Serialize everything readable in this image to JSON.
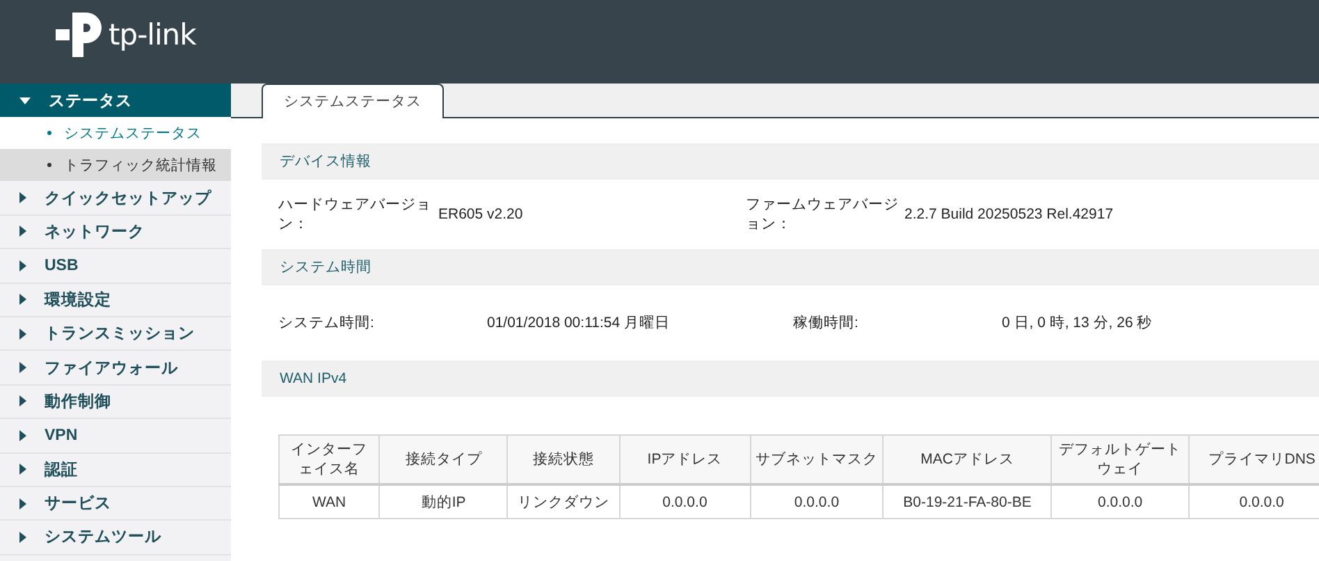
{
  "header": {
    "logo_text": "tp-link"
  },
  "sidebar": {
    "items": [
      {
        "label": "ステータス",
        "expanded": true,
        "selected": true,
        "children": [
          {
            "label": "システムステータス",
            "selected": true,
            "highlighted": false
          },
          {
            "label": "トラフィック統計情報",
            "selected": false,
            "highlighted": true
          }
        ]
      },
      {
        "label": "クイックセットアップ",
        "expanded": false,
        "selected": false
      },
      {
        "label": "ネットワーク",
        "expanded": false,
        "selected": false
      },
      {
        "label": "USB",
        "expanded": false,
        "selected": false
      },
      {
        "label": "環境設定",
        "expanded": false,
        "selected": false
      },
      {
        "label": "トランスミッション",
        "expanded": false,
        "selected": false
      },
      {
        "label": "ファイアウォール",
        "expanded": false,
        "selected": false
      },
      {
        "label": "動作制御",
        "expanded": false,
        "selected": false
      },
      {
        "label": "VPN",
        "expanded": false,
        "selected": false
      },
      {
        "label": "認証",
        "expanded": false,
        "selected": false
      },
      {
        "label": "サービス",
        "expanded": false,
        "selected": false
      },
      {
        "label": "システムツール",
        "expanded": false,
        "selected": false
      }
    ]
  },
  "tabs": [
    {
      "label": "システムステータス",
      "selected": true
    }
  ],
  "sections": [
    {
      "title": "デバイス情報",
      "kind": "version",
      "fields": [
        {
          "label": "ハードウェアバージョン：",
          "value": "ER605 v2.20"
        },
        {
          "label": "ファームウェアバージョン：",
          "value": "2.2.7 Build 20250523 Rel.42917"
        }
      ]
    },
    {
      "title": "システム時間",
      "kind": "time",
      "fields": [
        {
          "label": "システム時間:",
          "value": "01/01/2018 00:11:54 月曜日"
        },
        {
          "label": "稼働時間:",
          "value": "0 日, 0 時, 13 分, 26 秒"
        }
      ]
    },
    {
      "title": "WAN IPv4",
      "kind": "table",
      "table": {
        "columns": [
          "インターフェイス名",
          "接続タイプ",
          "接続状態",
          "IPアドレス",
          "サブネットマスク",
          "MACアドレス",
          "デフォルトゲートウェイ",
          "プライマリDNS"
        ],
        "rows": [
          [
            "WAN",
            "動的IP",
            "リンクダウン",
            "0.0.0.0",
            "0.0.0.0",
            "B0-19-21-FA-80-BE",
            "0.0.0.0",
            "0.0.0.0"
          ]
        ]
      }
    }
  ]
}
